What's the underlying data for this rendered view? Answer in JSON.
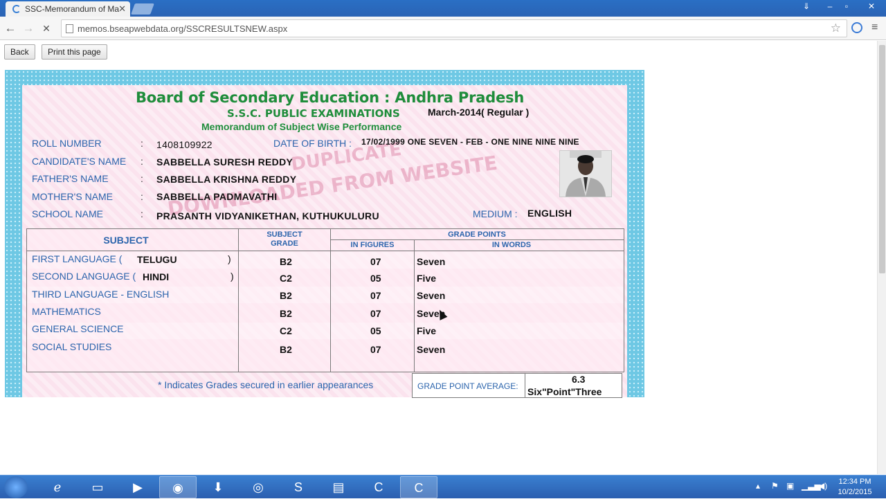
{
  "browser": {
    "tab_title": "SSC-Memorandum of Ma",
    "tab_close": "✕",
    "url": "memos.bseapwebdata.org/SSCRESULTSNEW.aspx",
    "back_icon": "arrow-left-icon",
    "forward_icon": "arrow-right-icon",
    "stop_icon": "close-icon",
    "star_icon": "star-icon",
    "menu_icon": "hamburger-icon"
  },
  "page": {
    "back_label": "Back",
    "print_label": "Print this page"
  },
  "memo": {
    "board": "Board of Secondary Education : Andhra Pradesh",
    "exam": "S.S.C. PUBLIC EXAMINATIONS",
    "session": "March-2014( Regular )",
    "subtitle": "Memorandum of Subject Wise Performance",
    "watermark_1": "DUPLICATE",
    "watermark_2": "DOWNLOADED FROM WEBSITE",
    "fields": {
      "roll_label": "ROLL NUMBER",
      "roll_value": "1408109922",
      "dob_label": "DATE OF BIRTH :",
      "dob_value": "17/02/1999  ONE SEVEN  - FEB -  ONE NINE NINE NINE",
      "candidate_label": "CANDIDATE'S NAME",
      "candidate_value": "SABBELLA SURESH REDDY",
      "father_label": "FATHER'S NAME",
      "father_value": "SABBELLA KRISHNA REDDY",
      "mother_label": "MOTHER'S NAME",
      "mother_value": "SABBELLA PADMAVATHI",
      "school_label": "SCHOOL NAME",
      "school_value": "PRASANTH VIDYANIKETHAN, KUTHUKULURU",
      "medium_label": "MEDIUM :",
      "medium_value": "ENGLISH",
      "colon": ":"
    },
    "table": {
      "col_subject": "SUBJECT",
      "col_grade_1": "SUBJECT",
      "col_grade_2": "GRADE",
      "col_points": "GRADE POINTS",
      "col_figures": "IN FIGURES",
      "col_words": "IN WORDS",
      "rows": [
        {
          "subject": "FIRST LANGUAGE  (",
          "lang": "TELUGU",
          "close": ")",
          "grade": "B2",
          "figures": "07",
          "words": "Seven"
        },
        {
          "subject": "SECOND LANGUAGE (",
          "lang": "HINDI",
          "close": ")",
          "grade": "C2",
          "figures": "05",
          "words": "Five"
        },
        {
          "subject": "THIRD LANGUAGE - ENGLISH",
          "lang": "",
          "close": "",
          "grade": "B2",
          "figures": "07",
          "words": "Seven"
        },
        {
          "subject": "MATHEMATICS",
          "lang": "",
          "close": "",
          "grade": "B2",
          "figures": "07",
          "words": "Seven"
        },
        {
          "subject": "GENERAL SCIENCE",
          "lang": "",
          "close": "",
          "grade": "C2",
          "figures": "05",
          "words": "Five"
        },
        {
          "subject": "SOCIAL STUDIES",
          "lang": "",
          "close": "",
          "grade": "B2",
          "figures": "07",
          "words": "Seven"
        }
      ]
    },
    "footnote": "* Indicates Grades secured in earlier appearances",
    "gpa_label": "GRADE POINT AVERAGE:",
    "gpa_value": "6.3",
    "gpa_words": "Six\"Point\"Three"
  },
  "taskbar": {
    "time": "12:34 PM",
    "date": "10/2/2015",
    "apps": [
      "windows-start-icon",
      "internet-explorer-icon",
      "file-explorer-icon",
      "media-player-icon",
      "chrome-icon",
      "download-icon",
      "app-spiral-icon",
      "skype-icon",
      "notepad-icon",
      "camtasia-icon",
      "camtasia-recorder-icon"
    ]
  },
  "colors": {
    "heading_green": "#1f8d3b",
    "label_blue": "#2b64ac",
    "border_cyan": "#6ec8e4",
    "panel_pink": "#fbe3ee"
  }
}
